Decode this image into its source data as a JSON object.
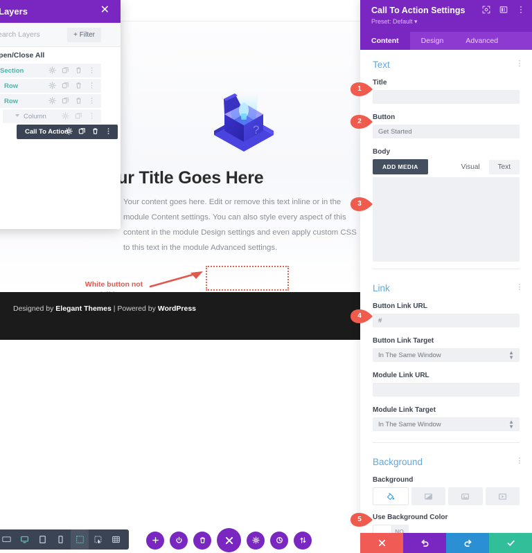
{
  "layers_panel": {
    "title": "Layers",
    "close_icon": "close-icon",
    "search_placeholder": "Search Layers",
    "filter_label": "Filter",
    "open_close_all": "Open/Close All",
    "rows": [
      {
        "label": "Section",
        "level": "section"
      },
      {
        "label": "Row",
        "level": "row"
      },
      {
        "label": "Row",
        "level": "row"
      },
      {
        "label": "Column",
        "level": "column"
      },
      {
        "label": "Call To Action",
        "level": "module"
      }
    ]
  },
  "canvas": {
    "cta_title": "Your Title Goes Here",
    "cta_body": "Your content goes here. Edit or remove this text inline or in the module Content settings. You can also style every aspect of this content in the module Design settings and even apply custom CSS to this text in the module Advanced settings.",
    "annotation": "White button not\nvisible yet",
    "annotation_line1": "White button not",
    "annotation_line2": "visible yet",
    "footer_prefix": "Designed by ",
    "footer_brand1": "Elegant Themes",
    "footer_mid": " | Powered by ",
    "footer_brand2": "WordPress"
  },
  "settings": {
    "title": "Call To Action Settings",
    "preset": "Preset: Default ▾",
    "header_icons": [
      "responsive-view-icon",
      "layout-columns-icon",
      "more-vertical-icon"
    ],
    "tabs": [
      {
        "label": "Content",
        "active": true
      },
      {
        "label": "Design",
        "active": false
      },
      {
        "label": "Advanced",
        "active": false
      }
    ],
    "text_group": {
      "heading": "Text",
      "title_label": "Title",
      "title_value": "",
      "button_label": "Button",
      "button_value": "Get Started",
      "body_label": "Body",
      "add_media_label": "ADD MEDIA",
      "editor_tabs": [
        {
          "label": "Visual",
          "active": false
        },
        {
          "label": "Text",
          "active": true
        }
      ],
      "body_value": ""
    },
    "link_group": {
      "heading": "Link",
      "button_link_url_label": "Button Link URL",
      "button_link_url_value": "#",
      "button_link_target_label": "Button Link Target",
      "button_link_target_value": "In The Same Window",
      "module_link_url_label": "Module Link URL",
      "module_link_url_value": "",
      "module_link_target_label": "Module Link Target",
      "module_link_target_value": "In The Same Window"
    },
    "background_group": {
      "heading": "Background",
      "background_label": "Background",
      "bg_tabs": [
        {
          "icon": "color-fill-icon",
          "active": true
        },
        {
          "icon": "gradient-icon",
          "active": false
        },
        {
          "icon": "image-icon",
          "active": false
        },
        {
          "icon": "video-icon",
          "active": false
        }
      ],
      "use_bg_color_label": "Use Background Color",
      "use_bg_color_value": "NO"
    },
    "actions": [
      {
        "name": "discard-button",
        "icon": "close-icon",
        "color": "#f05b55"
      },
      {
        "name": "undo-button",
        "icon": "undo-icon",
        "color": "#7a26c1"
      },
      {
        "name": "redo-button",
        "icon": "redo-icon",
        "color": "#2b8fd4"
      },
      {
        "name": "save-button",
        "icon": "check-icon",
        "color": "#31bf9a"
      }
    ]
  },
  "bottom_bar": {
    "device_group": [
      {
        "name": "desktop-wide-icon",
        "active": false
      },
      {
        "name": "desktop-icon",
        "active": false
      },
      {
        "name": "tablet-icon",
        "active": false
      },
      {
        "name": "phone-icon",
        "active": false
      }
    ],
    "tool_group": [
      {
        "name": "wireframe-icon",
        "active": true
      },
      {
        "name": "zoom-out-icon",
        "active": false
      },
      {
        "name": "grid-icon",
        "active": false
      }
    ],
    "fabs": [
      {
        "name": "add-icon",
        "big": false
      },
      {
        "name": "power-icon",
        "big": false
      },
      {
        "name": "trash-icon",
        "big": false
      },
      {
        "name": "close-icon",
        "big": true
      },
      {
        "name": "settings-icon",
        "big": false
      },
      {
        "name": "history-icon",
        "big": false
      },
      {
        "name": "portability-icon",
        "big": false
      }
    ]
  },
  "callouts": [
    {
      "number": "1"
    },
    {
      "number": "2"
    },
    {
      "number": "3"
    },
    {
      "number": "4"
    },
    {
      "number": "5"
    }
  ],
  "colors": {
    "brand_purple": "#7a26c1",
    "tab_purple": "#8d3ad0",
    "accent_blue": "#5fa8dd",
    "callout_red": "#ef5c4e",
    "teal_layer": "#47b6a8",
    "dark_slate": "#3b4455"
  }
}
